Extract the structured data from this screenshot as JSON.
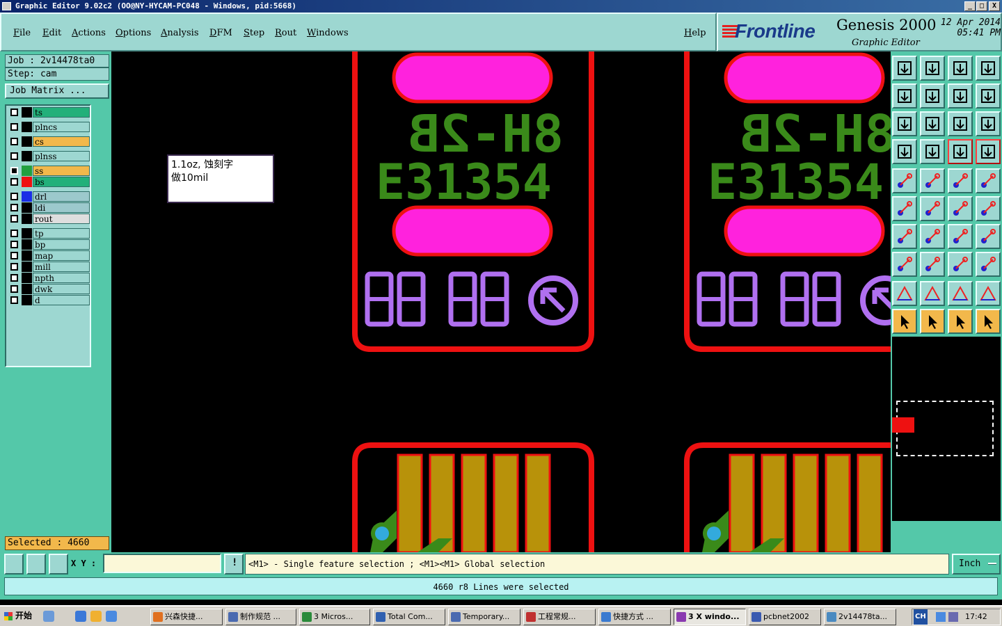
{
  "window": {
    "title": "Graphic Editor 9.02c2 (OO@NY-HYCAM-PC048 - Windows, pid:5668)",
    "controls": [
      "_",
      "□",
      "X"
    ]
  },
  "menu": [
    "File",
    "Edit",
    "Actions",
    "Options",
    "Analysis",
    "DFM",
    "Step",
    "Rout",
    "Windows"
  ],
  "help_label": "Help",
  "brand": {
    "logo": "Frontline",
    "product": "Genesis 2000",
    "subtitle": "Graphic Editor",
    "date": "12 Apr 2014",
    "time": "05:41 PM"
  },
  "job": {
    "job_label": "Job : 2v14478ta0",
    "step_label": "Step: cam",
    "matrix_button": "Job Matrix ..."
  },
  "layers": [
    {
      "name": "ts",
      "color": "#22b07a",
      "swatch": "#000000"
    },
    {
      "name": "plncs",
      "color": "#9dd7d1",
      "swatch": "#000000"
    },
    {
      "name": "cs",
      "color": "#f2b84b",
      "swatch": "#000000"
    },
    {
      "name": "plnss",
      "color": "#9dd7d1",
      "swatch": "#000000"
    },
    {
      "name": "ss",
      "color": "#f2b84b",
      "swatch": "#22a040",
      "active": true
    },
    {
      "name": "bs",
      "color": "#22b07a",
      "swatch": "#ee1111"
    },
    {
      "name": "drl",
      "color": "#9cc9cc",
      "swatch": "#1a2ee6"
    },
    {
      "name": "ldi",
      "color": "#9cc9cc",
      "swatch": "#000000"
    },
    {
      "name": "rout",
      "color": "#dedede",
      "swatch": "#000000"
    },
    {
      "name": "tp",
      "color": "#9dd7d1",
      "swatch": "#000000"
    },
    {
      "name": "bp",
      "color": "#9dd7d1",
      "swatch": "#000000"
    },
    {
      "name": "map",
      "color": "#9dd7d1",
      "swatch": "#000000"
    },
    {
      "name": "mill",
      "color": "#9dd7d1",
      "swatch": "#000000"
    },
    {
      "name": "npth",
      "color": "#9dd7d1",
      "swatch": "#000000"
    },
    {
      "name": "dwk",
      "color": "#9dd7d1",
      "swatch": "#000000"
    },
    {
      "name": "d",
      "color": "#9dd7d1",
      "swatch": "#000000"
    }
  ],
  "selected_count_label": "Selected : 4660",
  "canvas": {
    "note_line1": "1.1oz, 蚀刻字",
    "note_line2": "做10mil",
    "silk_text_line1": "8H-2B",
    "silk_text_line2": "E31354",
    "colors": {
      "outline": "#ee1111",
      "pad": "#ff22dd",
      "silk": "#3a8a1a",
      "digits": "#b070f0",
      "finger": "#b8920a",
      "hole": "#33aadd"
    }
  },
  "command": {
    "xy_label": "X Y :",
    "xy_value": "",
    "hint": "<M1> - Single feature selection ; <M1><M1> Global selection",
    "unit": "Inch"
  },
  "status_message": "4660 r8 Lines were selected",
  "taskbar": {
    "start": "开始",
    "tasks": [
      "兴森快捷...",
      "制作规范 ...",
      "3 Micros...",
      "Total Com...",
      "Temporary...",
      "工程常规...",
      "快捷方式 ...",
      "3 X windo...",
      "pcbnet2002",
      "2v14478ta..."
    ],
    "clock": "17:42",
    "tray_label": "CH"
  }
}
